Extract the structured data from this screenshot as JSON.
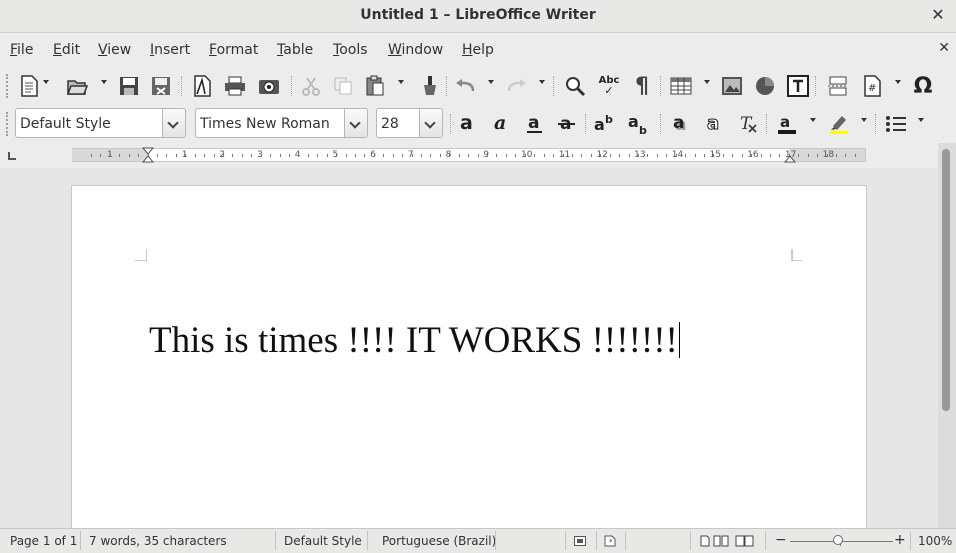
{
  "window": {
    "title": "Untitled 1 – LibreOffice Writer",
    "close_glyph": "✕"
  },
  "menu": {
    "items": [
      {
        "label": "File",
        "u": "F",
        "rest": "ile"
      },
      {
        "label": "Edit",
        "u": "E",
        "rest": "dit"
      },
      {
        "label": "View",
        "u": "V",
        "rest": "iew"
      },
      {
        "label": "Insert",
        "u": "I",
        "rest": "nsert"
      },
      {
        "label": "Format",
        "u": "F",
        "pre": "",
        "rest": "ormat"
      },
      {
        "label": "Table",
        "u": "T",
        "rest": "able"
      },
      {
        "label": "Tools",
        "u": "T",
        "rest": "ools"
      },
      {
        "label": "Window",
        "u": "W",
        "rest": "indow"
      },
      {
        "label": "Help",
        "u": "H",
        "rest": "elp"
      }
    ],
    "doc_close_glyph": "✕"
  },
  "formatting": {
    "paragraph_style": "Default Style",
    "font_name": "Times New Roman",
    "font_size": "28"
  },
  "ruler": {
    "numbers": [
      "1",
      "1",
      "2",
      "3",
      "4",
      "5",
      "6",
      "7",
      "8",
      "9",
      "10",
      "11",
      "12",
      "13",
      "14",
      "15",
      "16",
      "17",
      "18"
    ]
  },
  "document": {
    "text": "This is times !!!! IT WORKS !!!!!!!"
  },
  "status": {
    "page": "Page 1 of 1",
    "words": "7 words, 35 characters",
    "page_style": "Default Style",
    "language": "Portuguese (Brazil)",
    "zoom_minus": "−",
    "zoom_plus": "+",
    "zoom_level": "100%"
  },
  "toolbar_glyphs": {
    "special_char": "Ω",
    "pilcrow": "¶",
    "spell": "Abc",
    "field": "#"
  },
  "colors": {
    "font_color_bar": "#1a1a1a",
    "highlight_bar": "#ffff00",
    "chart_red": "#c0392b"
  }
}
